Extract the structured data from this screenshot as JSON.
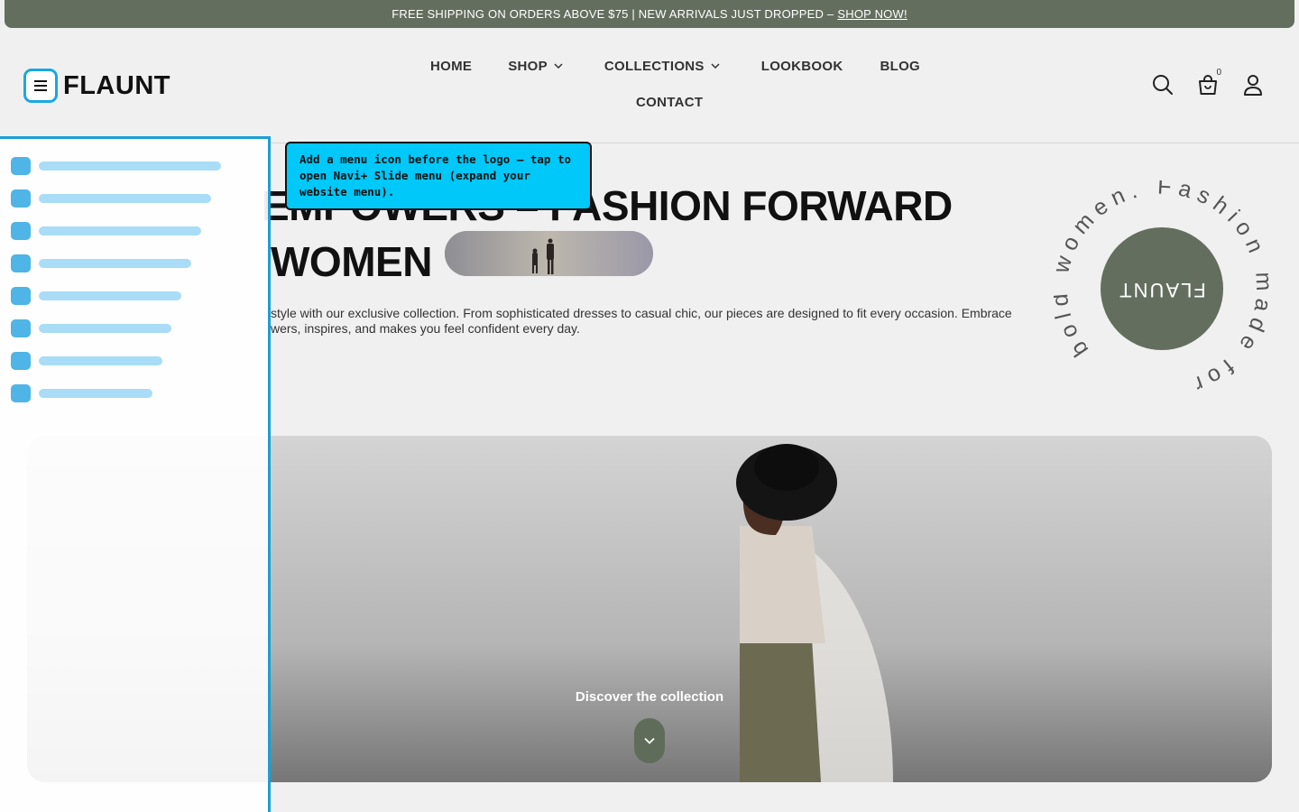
{
  "announcement": {
    "text": "FREE SHIPPING ON ORDERS ABOVE $75 | NEW ARRIVALS JUST DROPPED –",
    "link": "SHOP NOW!"
  },
  "header": {
    "logo": "FLAUNT",
    "nav": {
      "home": "HOME",
      "shop": "SHOP",
      "collections": "COLLECTIONS",
      "lookbook": "LOOKBOOK",
      "blog": "BLOG",
      "contact": "CONTACT"
    },
    "cart_count": "0"
  },
  "hero": {
    "title_line1": "FASHION FORWARD",
    "title_line2": "WOMEN",
    "title_partial": "EMPOWERS –",
    "description_line1": "style with our exclusive collection. From sophisticated dresses to casual chic, our pieces are designed to fit every occasion. Embrace",
    "description_line2": "wers, inspires, and makes you feel confident every day.",
    "discover": "Discover the collection"
  },
  "badge": {
    "center": "FLAUNT",
    "ring_text": "bold women. Fashion made for"
  },
  "tooltip": {
    "text": "Add a menu icon before the logo — tap to open Navi+ Slide menu (expand your website menu)."
  },
  "colors": {
    "brand_green": "#636e5f",
    "accent_blue": "#1aa7e0",
    "tooltip_bg": "#00c8f8"
  }
}
